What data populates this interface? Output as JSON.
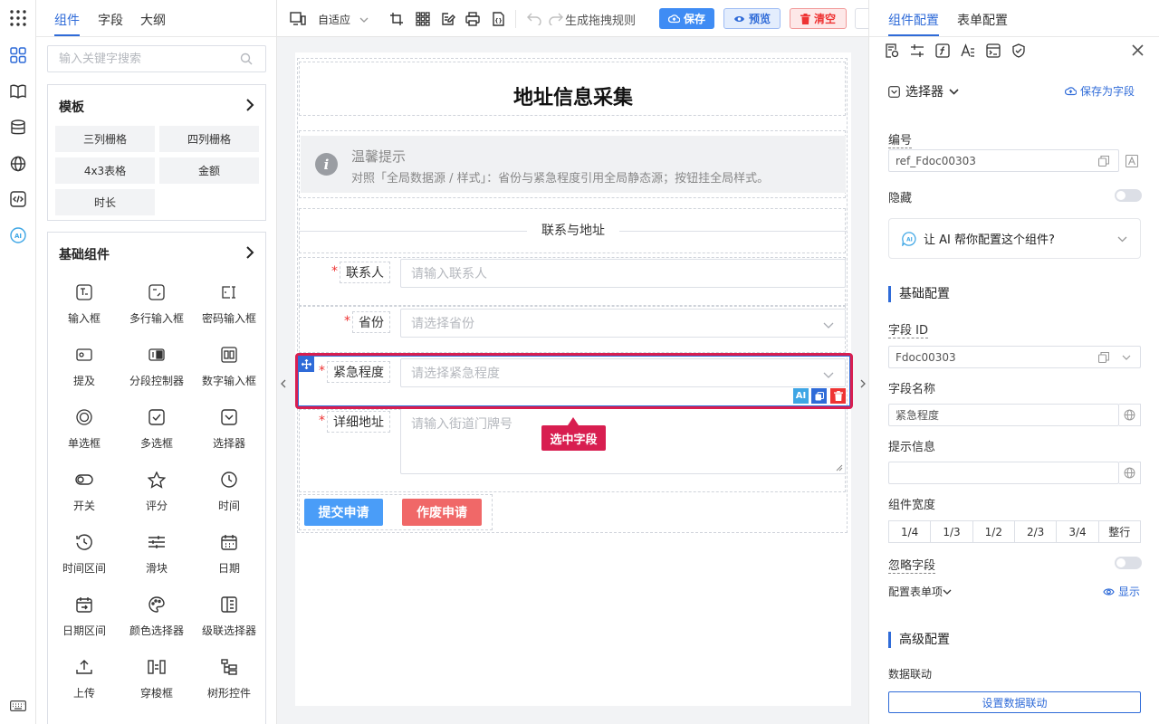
{
  "left_panel": {
    "tabs": [
      "组件",
      "字段",
      "大纲"
    ],
    "search_placeholder": "输入关键字搜索",
    "templates": {
      "title": "模板",
      "items": [
        "三列栅格",
        "四列栅格",
        "4x3表格",
        "金额",
        "时长"
      ]
    },
    "basic": {
      "title": "基础组件",
      "items": [
        "输入框",
        "多行输入框",
        "密码输入框",
        "提及",
        "分段控制器",
        "数字输入框",
        "单选框",
        "多选框",
        "选择器",
        "开关",
        "评分",
        "时间",
        "时间区间",
        "滑块",
        "日期",
        "日期区间",
        "颜色选择器",
        "级联选择器",
        "上传",
        "穿梭框",
        "树形控件"
      ]
    }
  },
  "toolbar": {
    "mode": "自适应",
    "rule_label": "生成拖拽规则",
    "save": "保存",
    "preview": "预览",
    "clear": "清空"
  },
  "form": {
    "title": "地址信息采集",
    "alert_title": "温馨提示",
    "alert_desc": "对照「全局数据源 / 样式」：省份与紧急程度引用全局静态源；按钮挂全局样式。",
    "divider": "联系与地址",
    "fields": [
      {
        "label": "联系人",
        "placeholder": "请输入联系人"
      },
      {
        "label": "省份",
        "placeholder": "请选择省份"
      },
      {
        "label": "紧急程度",
        "placeholder": "请选择紧急程度"
      },
      {
        "label": "详细地址",
        "placeholder": "请输入街道门牌号"
      }
    ],
    "submit": "提交申请",
    "cancel": "作废申请",
    "selected_tag": "选中字段",
    "ai_badge": "AI"
  },
  "right_panel": {
    "tabs": [
      "组件配置",
      "表单配置"
    ],
    "component_type": "选择器",
    "save_as_field": "保存为字段",
    "id_label": "编号",
    "id_value": "ref_Fdoc00303",
    "hidden_label": "隐藏",
    "ai_prompt": "让 AI 帮你配置这个组件?",
    "basic_title": "基础配置",
    "field_id_label": "字段 ID",
    "field_id_value": "Fdoc00303",
    "field_name_label": "字段名称",
    "field_name_value": "紧急程度",
    "hint_label": "提示信息",
    "hint_value": "",
    "width_label": "组件宽度",
    "widths": [
      "1/4",
      "1/3",
      "1/2",
      "2/3",
      "3/4",
      "整行"
    ],
    "ignore_label": "忽略字段",
    "config_items_label": "配置表单项",
    "show_label": "显示",
    "advanced_title": "高级配置",
    "linkage_label": "数据联动",
    "linkage_button": "设置数据联动"
  },
  "colors": {
    "primary": "#2f6bd8",
    "selected": "#d81e50",
    "submit": "#4a9df8",
    "cancel": "#f06868"
  }
}
